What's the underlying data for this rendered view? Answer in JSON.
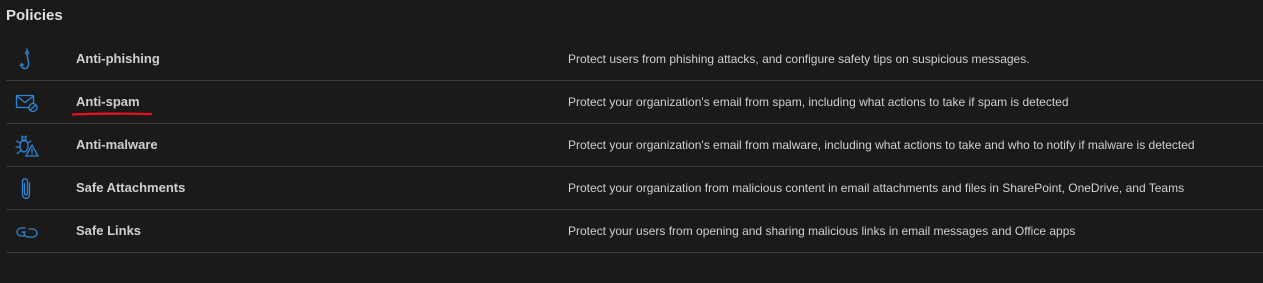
{
  "section": {
    "title": "Policies"
  },
  "policies": [
    {
      "icon": "hook-icon",
      "name": "Anti-phishing",
      "description": "Protect users from phishing attacks, and configure safety tips on suspicious messages."
    },
    {
      "icon": "mail-blocked-icon",
      "name": "Anti-spam",
      "description": "Protect your organization's email from spam, including what actions to take if spam is detected"
    },
    {
      "icon": "bug-warning-icon",
      "name": "Anti-malware",
      "description": "Protect your organization's email from malware, including what actions to take and who to notify if malware is detected"
    },
    {
      "icon": "paperclip-icon",
      "name": "Safe Attachments",
      "description": "Protect your organization from malicious content in email attachments and files in SharePoint, OneDrive, and Teams"
    },
    {
      "icon": "link-icon",
      "name": "Safe Links",
      "description": "Protect your users from opening and sharing malicious links in email messages and Office apps"
    }
  ],
  "colors": {
    "background": "#1b1a19",
    "icon_accent": "#2b88d8",
    "divider": "#3b3a39",
    "annotation_underline": "#e81123"
  }
}
